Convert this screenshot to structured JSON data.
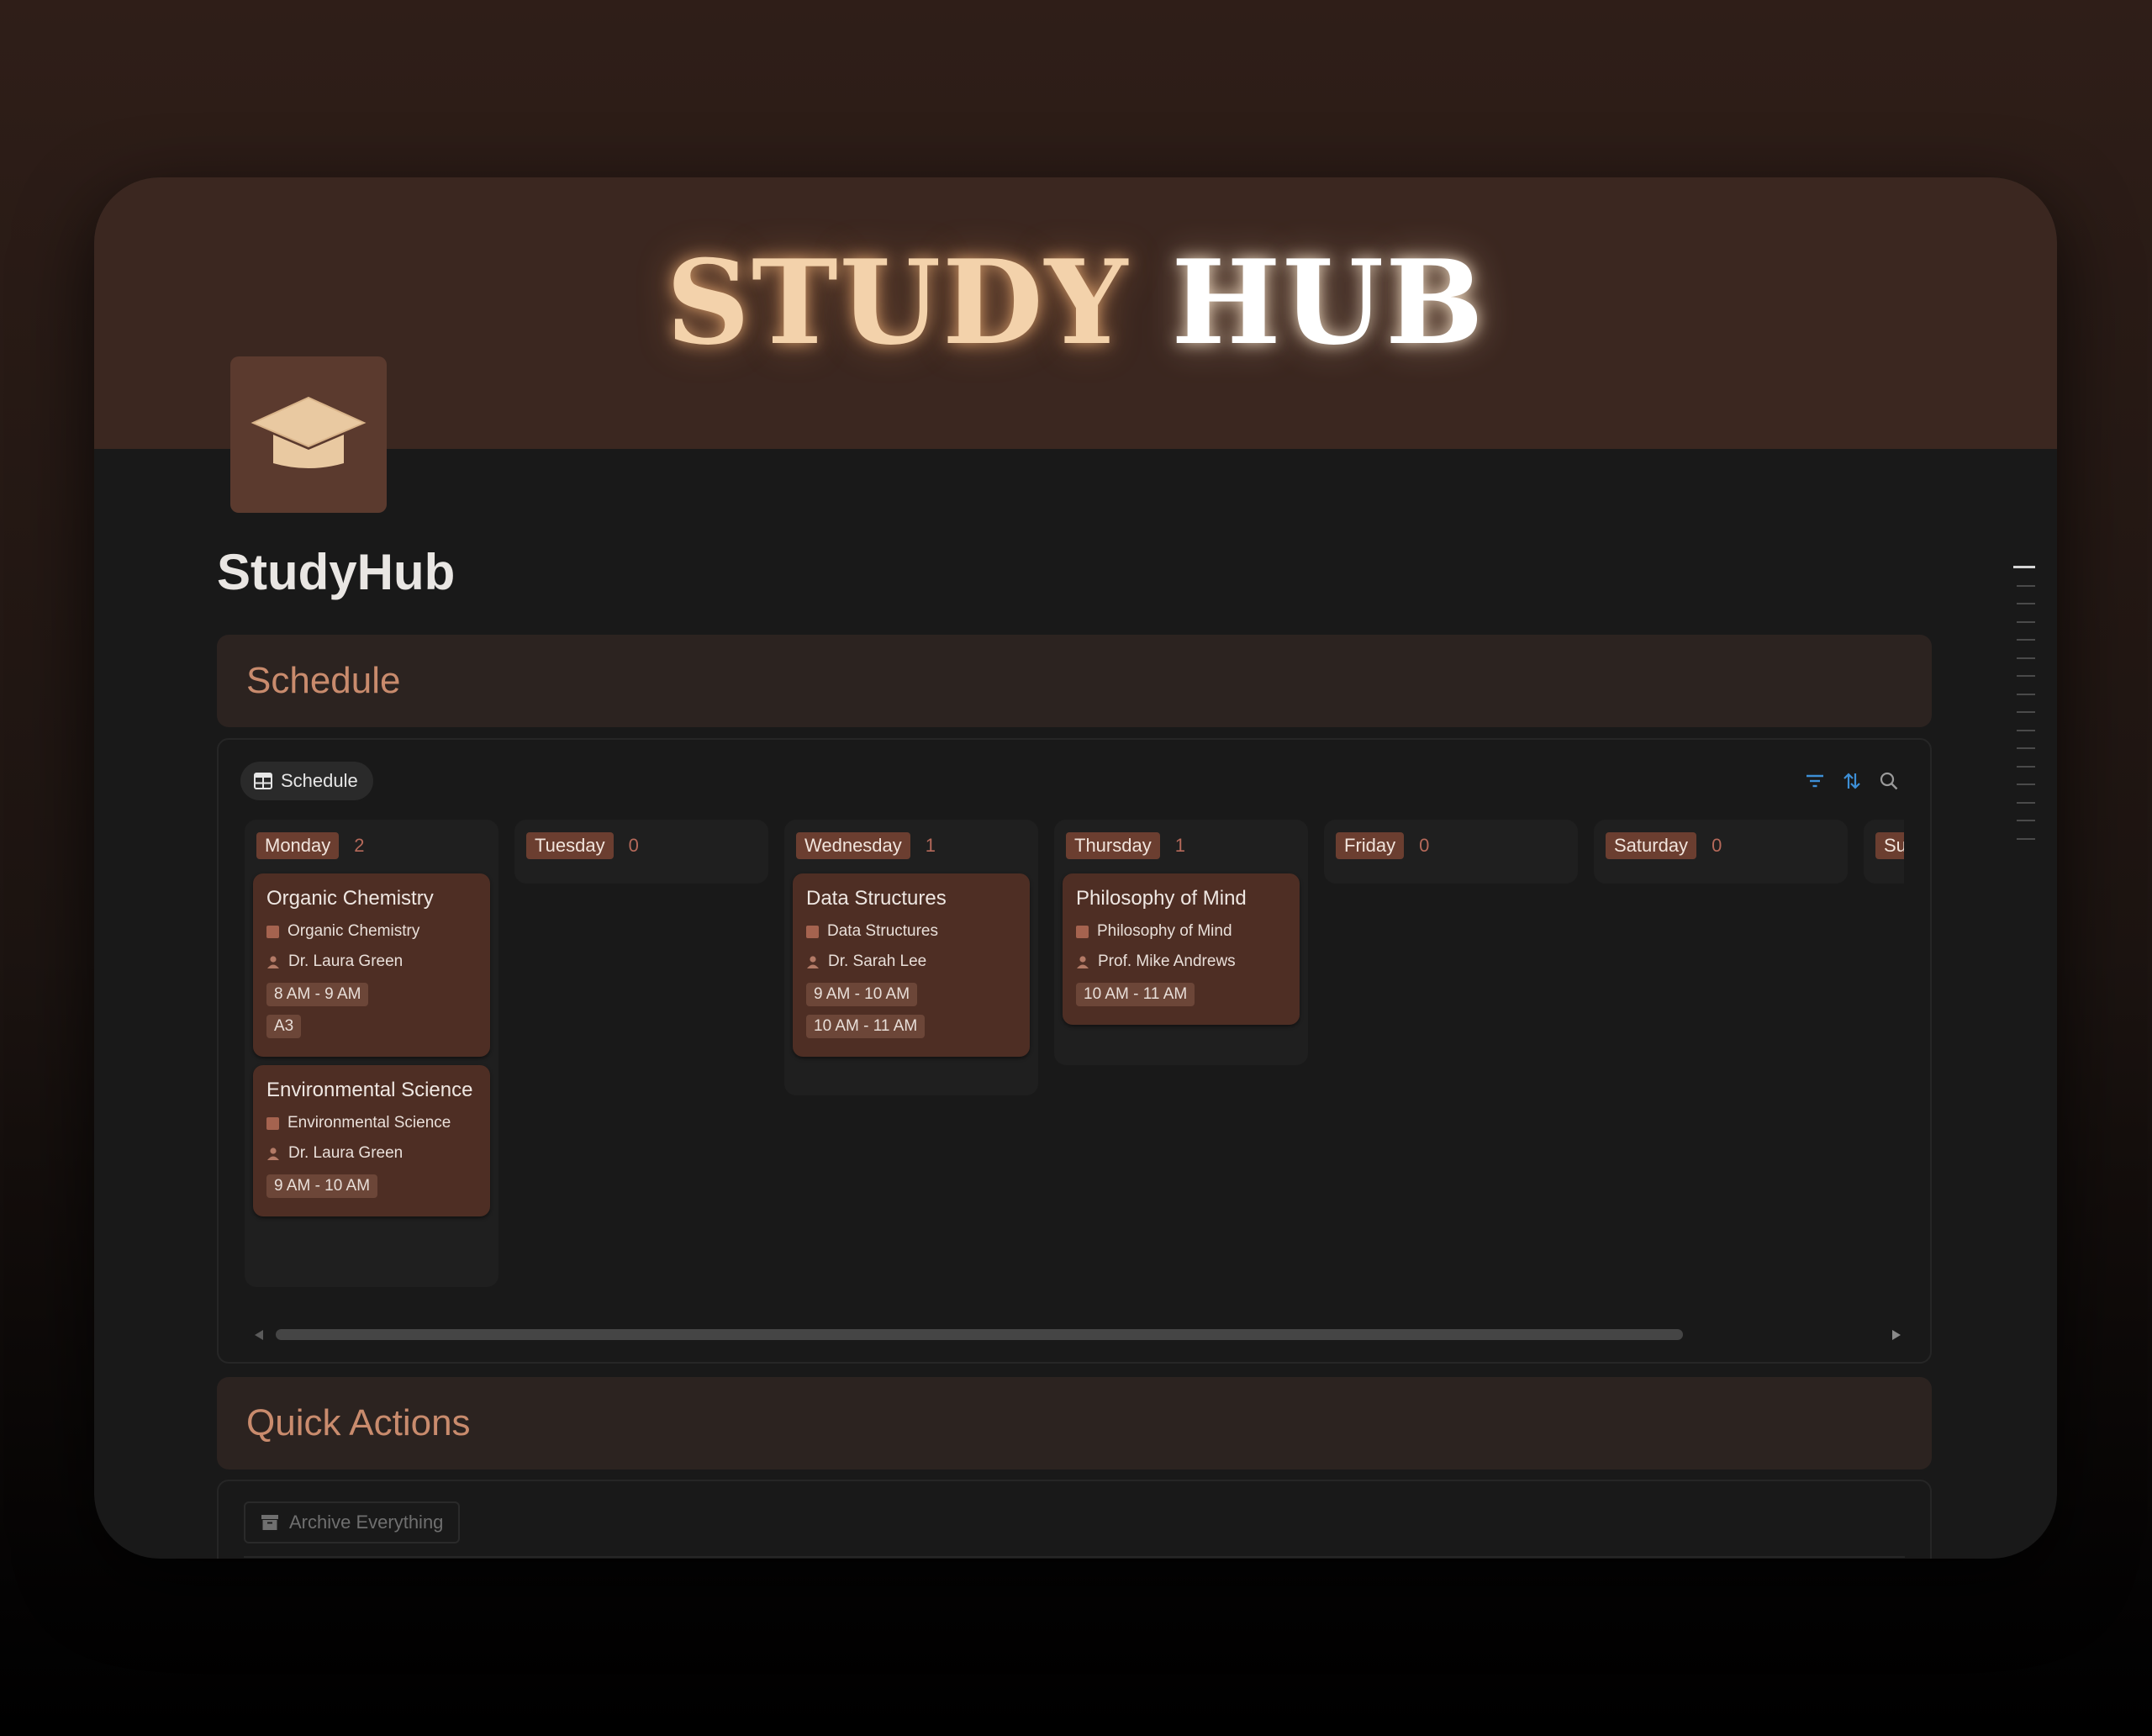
{
  "header": {
    "title_part1": "STUDY",
    "title_part2": "HUB",
    "icon": "graduation-cap-icon"
  },
  "page": {
    "title": "StudyHub"
  },
  "schedule_section": {
    "heading": "Schedule",
    "view_tab_label": "Schedule",
    "view_tab_icon": "table-icon",
    "tools": [
      "filter-icon",
      "sort-icon",
      "search-icon"
    ],
    "columns": [
      {
        "day": "Monday",
        "count": "2",
        "cards": [
          {
            "title": "Organic Chemistry",
            "course": "Organic Chemistry",
            "instructor": "Dr. Laura Green",
            "times": [
              "8 AM - 9 AM"
            ],
            "room": "A3"
          },
          {
            "title": "Environmental Science",
            "course": "Environmental Science",
            "instructor": "Dr. Laura Green",
            "times": [
              "9 AM - 10 AM"
            ],
            "room": ""
          }
        ]
      },
      {
        "day": "Tuesday",
        "count": "0",
        "cards": []
      },
      {
        "day": "Wednesday",
        "count": "1",
        "cards": [
          {
            "title": "Data Structures",
            "course": "Data Structures",
            "instructor": "Dr. Sarah Lee",
            "times": [
              "9 AM - 10 AM",
              "10 AM - 11 AM"
            ],
            "room": ""
          }
        ]
      },
      {
        "day": "Thursday",
        "count": "1",
        "cards": [
          {
            "title": "Philosophy of Mind",
            "course": "Philosophy of Mind",
            "instructor": "Prof. Mike Andrews",
            "times": [
              "10 AM - 11 AM"
            ],
            "room": ""
          }
        ]
      },
      {
        "day": "Friday",
        "count": "0",
        "cards": []
      },
      {
        "day": "Saturday",
        "count": "0",
        "cards": []
      },
      {
        "day": "Su",
        "count": "",
        "cards": []
      }
    ]
  },
  "quick_actions": {
    "heading": "Quick Actions",
    "archive_label": "Archive Everything",
    "archive_icon": "archive-box-icon"
  },
  "colors": {
    "cover": "#3b2720",
    "accent": "#c98b6d",
    "card": "#4e2e24",
    "day_pill": "#6b3e30"
  }
}
